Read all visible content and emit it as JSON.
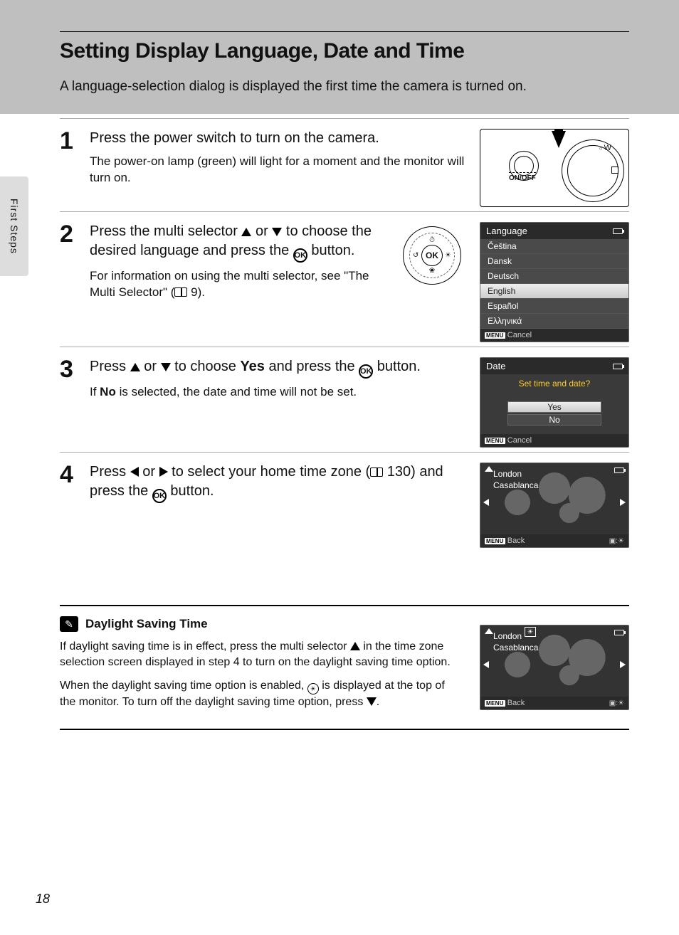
{
  "header": {
    "title": "Setting Display Language, Date and Time",
    "intro": "A language-selection dialog is displayed the first time the camera is turned on."
  },
  "sideTab": "First Steps",
  "steps": {
    "s1": {
      "num": "1",
      "head": "Press the power switch to turn on the camera.",
      "sub": "The power-on lamp (green) will light for a moment and the monitor will turn on.",
      "onoff": "ON/OFF",
      "w": "W"
    },
    "s2": {
      "num": "2",
      "head_a": "Press the multi selector ",
      "head_b": " or ",
      "head_c": " to choose the desired language and press the ",
      "head_d": " button.",
      "sub_a": "For information on using the multi selector, see \"The Multi Selector\" (",
      "sub_b": " 9).",
      "ok": "OK"
    },
    "s3": {
      "num": "3",
      "head_a": "Press ",
      "head_b": " or ",
      "head_c": " to choose ",
      "head_yes": "Yes",
      "head_d": " and press the ",
      "head_e": " button.",
      "sub_a": "If ",
      "sub_no": "No",
      "sub_b": " is selected, the date and time will not be set."
    },
    "s4": {
      "num": "4",
      "head_a": "Press ",
      "head_b": " or ",
      "head_c": " to select your home time zone (",
      "head_ref": " 130) and press the ",
      "head_d": " button."
    }
  },
  "langScreen": {
    "title": "Language",
    "items": [
      "Čeština",
      "Dansk",
      "Deutsch",
      "English",
      "Español",
      "Ελληνικά"
    ],
    "selectedIndex": 3,
    "cancel": "Cancel",
    "menu": "MENU"
  },
  "dateScreen": {
    "title": "Date",
    "prompt": "Set time and date?",
    "yes": "Yes",
    "no": "No",
    "cancel": "Cancel",
    "menu": "MENU"
  },
  "tzScreen": {
    "city1": "London",
    "city2": "Casablanca",
    "back": "Back",
    "menu": "MENU"
  },
  "tip": {
    "title": "Daylight Saving Time",
    "p1_a": "If daylight saving time is in effect, press the multi selector ",
    "p1_b": " in the time zone selection screen displayed in step 4 to turn on the daylight saving time option.",
    "p2_a": "When the daylight saving time option is enabled, ",
    "p2_b": " is displayed at the top of the monitor. To turn off the daylight saving time option, press ",
    "p2_c": "."
  },
  "pageNum": "18"
}
